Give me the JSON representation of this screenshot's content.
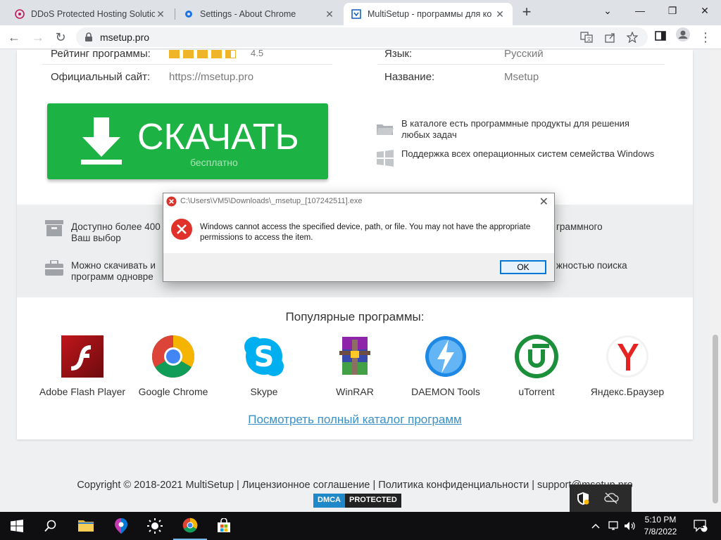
{
  "browser": {
    "tabs": [
      {
        "title": "DDoS Protected Hosting Solutio",
        "favicon": "ddos-favicon"
      },
      {
        "title": "Settings - About Chrome",
        "favicon": "settings-gear-icon"
      },
      {
        "title": "MultiSetup - программы для ко",
        "favicon": "msetup-favicon"
      }
    ],
    "url": "msetup.pro"
  },
  "info": {
    "rating_label": "Рейтинг программы:",
    "rating_value": "4.5",
    "rating_stars": 4.5,
    "site_label": "Официальный сайт:",
    "site_value": "https://msetup.pro",
    "lang_label": "Язык:",
    "lang_value": "Русский",
    "name_label": "Название:",
    "name_value": "Msetup"
  },
  "download": {
    "label": "СКАЧАТЬ",
    "sub": "бесплатно"
  },
  "features": {
    "catalog": "В каталоге есть программные продукты для решения любых задач",
    "os": "Поддержка всех операционных систем семейства Windows",
    "available": "Доступно более 400",
    "available_2": "Ваш выбор",
    "available_right": "граммного",
    "download_many": "Можно скачивать и",
    "download_many_2": "программ одновре",
    "download_many_right": "жностью поиска"
  },
  "popular": {
    "title": "Популярные программы:",
    "programs": [
      {
        "name": "Adobe Flash Player",
        "icon": "flash-icon"
      },
      {
        "name": "Google Chrome",
        "icon": "chrome-icon"
      },
      {
        "name": "Skype",
        "icon": "skype-icon"
      },
      {
        "name": "WinRAR",
        "icon": "winrar-icon"
      },
      {
        "name": "DAEMON Tools",
        "icon": "daemon-tools-icon"
      },
      {
        "name": "uTorrent",
        "icon": "utorrent-icon"
      },
      {
        "name": "Яндекс.Браузер",
        "icon": "yandex-browser-icon"
      }
    ],
    "catalog_link": "Посмотреть полный каталог программ"
  },
  "footer": {
    "copyright": "Copyright © 2018-2021 MultiSetup | Лицензионное соглашение | Политика конфиденциальности | support@msetup.pro",
    "dmca_a": "DMCA",
    "dmca_b": "PROTECTED"
  },
  "dialog": {
    "title": "C:\\Users\\VM5\\Downloads\\_msetup_[107242511].exe",
    "message": "Windows cannot access the specified device, path, or file. You may not have the appropriate permissions to access the item.",
    "ok": "OK"
  },
  "taskbar": {
    "time": "5:10 PM",
    "date": "7/8/2022",
    "notification_count": "1"
  },
  "colors": {
    "download_green": "#1db344",
    "link_blue": "#3a8fc6",
    "star": "#f0b429"
  }
}
